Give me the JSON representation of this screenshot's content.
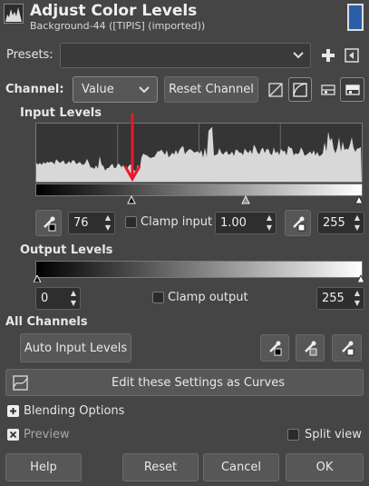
{
  "header": {
    "title": "Adjust Color Levels",
    "subtitle": "Background-44 ([TIPIS] (imported))"
  },
  "presets": {
    "label": "Presets:",
    "value": ""
  },
  "channel": {
    "label": "Channel:",
    "value": "Value",
    "reset_label": "Reset Channel"
  },
  "input_levels": {
    "heading": "Input Levels",
    "low": "76",
    "gamma": "1.00",
    "high": "255",
    "clamp_label": "Clamp input",
    "clamp_checked": false,
    "low_fraction": 0.298,
    "gamma_fraction": 0.649,
    "high_fraction": 1.0
  },
  "output_levels": {
    "heading": "Output Levels",
    "low": "0",
    "high": "255",
    "clamp_label": "Clamp output",
    "clamp_checked": false
  },
  "all_channels": {
    "heading": "All Channels",
    "auto_label": "Auto Input Levels"
  },
  "curves_label": "Edit these Settings as Curves",
  "blending_label": "Blending Options",
  "preview": {
    "label": "Preview",
    "checked": true
  },
  "split_view": {
    "label": "Split view",
    "checked": false
  },
  "footer": {
    "help": "Help",
    "reset": "Reset",
    "cancel": "Cancel",
    "ok": "OK"
  },
  "colors": {
    "background": "#454545",
    "annotation_arrow": "#e8182b",
    "histogram_fill": "#d8d8d8",
    "swatch": "#2b5ea8"
  },
  "icons": [
    "levels-icon",
    "chevron-down-icon",
    "plus-icon",
    "menu-left-icon",
    "linear-histogram-icon",
    "log-histogram-icon",
    "picker-black-icon",
    "picker-gray-icon",
    "picker-white-icon",
    "curves-icon",
    "close-icon"
  ]
}
